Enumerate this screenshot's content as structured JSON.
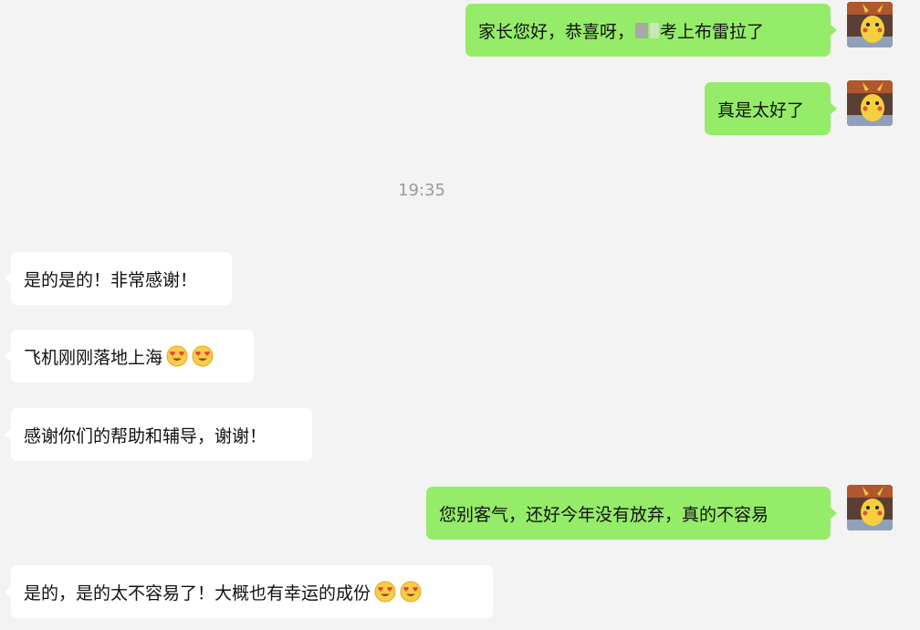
{
  "timestamp": "19:35",
  "colors": {
    "background": "#f3f3f3",
    "sent_bubble": "#95ec69",
    "received_bubble": "#ffffff",
    "timestamp_text": "#9a9a9a"
  },
  "messages": [
    {
      "direction": "sent",
      "text_before_redaction": "家长您好，恭喜呀，",
      "text_after_redaction": "考上布雷拉了",
      "redacted": true
    },
    {
      "direction": "sent",
      "text": "真是太好了"
    },
    {
      "direction": "received",
      "text": "是的是的！非常感谢！"
    },
    {
      "direction": "received",
      "text": "飞机刚刚落地上海",
      "emoji": [
        "heart-eyes-emoji",
        "heart-eyes-emoji"
      ]
    },
    {
      "direction": "received",
      "text": "感谢你们的帮助和辅导，谢谢！"
    },
    {
      "direction": "sent",
      "text": "您别客气，还好今年没有放弃，真的不容易"
    },
    {
      "direction": "received",
      "text": "是的，是的太不容易了！大概也有幸运的成份",
      "emoji": [
        "heart-eyes-emoji",
        "heart-eyes-emoji"
      ]
    }
  ],
  "avatar": {
    "icon": "pikachu-avatar"
  }
}
